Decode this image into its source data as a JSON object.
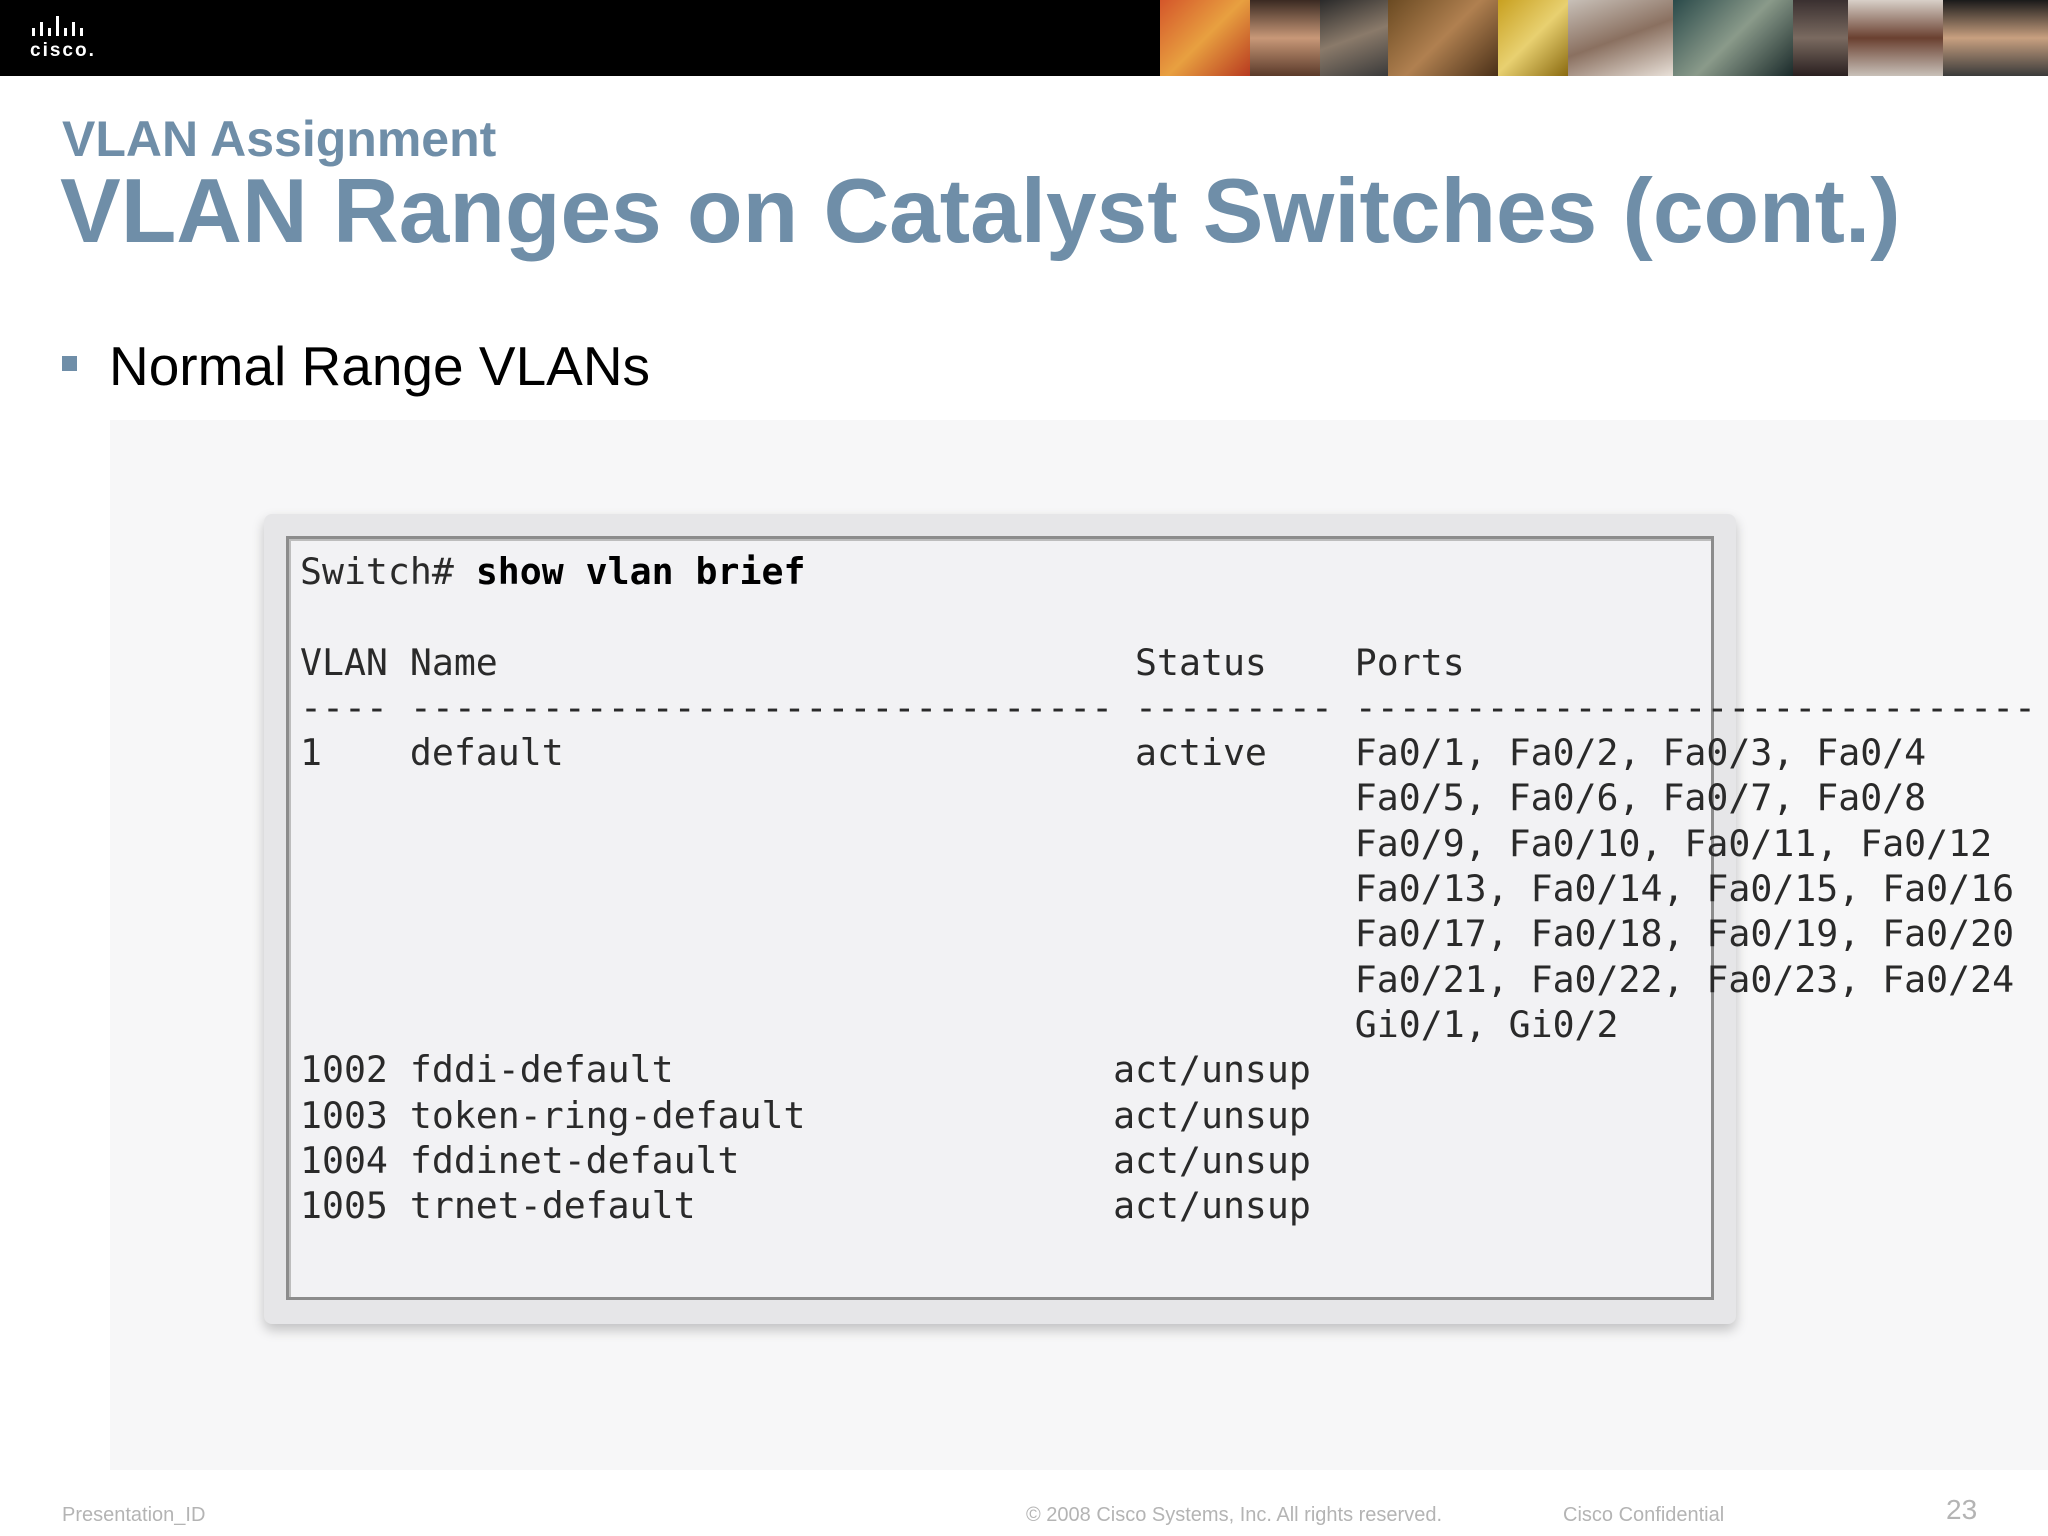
{
  "header": {
    "logo_text": "cisco.",
    "photo_strip_icon": "people-photo-strip"
  },
  "slide": {
    "section_title": "VLAN Assignment",
    "title": "VLAN Ranges on Catalyst Switches (cont.)",
    "bullet": "Normal Range VLANs",
    "bullet_icon": "square-bullet-icon"
  },
  "terminal": {
    "prompt": "Switch#",
    "command": "show vlan brief",
    "header_line": "VLAN Name                             Status    Ports",
    "separator_line": "---- -------------------------------- --------- -------------------------------",
    "lines": [
      "1    default                          active    Fa0/1, Fa0/2, Fa0/3, Fa0/4",
      "                                                Fa0/5, Fa0/6, Fa0/7, Fa0/8",
      "                                                Fa0/9, Fa0/10, Fa0/11, Fa0/12",
      "                                                Fa0/13, Fa0/14, Fa0/15, Fa0/16",
      "                                                Fa0/17, Fa0/18, Fa0/19, Fa0/20",
      "                                                Fa0/21, Fa0/22, Fa0/23, Fa0/24",
      "                                                Gi0/1, Gi0/2",
      "1002 fddi-default                    act/unsup",
      "1003 token-ring-default              act/unsup",
      "1004 fddinet-default                 act/unsup",
      "1005 trnet-default                   act/unsup"
    ]
  },
  "footer": {
    "presentation_id": "Presentation_ID",
    "copyright": "© 2008 Cisco Systems, Inc. All rights reserved.",
    "confidential": "Cisco Confidential",
    "page_number": "23"
  },
  "colors": {
    "title": "#6f8ea8",
    "topbar": "#000000",
    "terminal_bg": "#f2f2f4"
  }
}
